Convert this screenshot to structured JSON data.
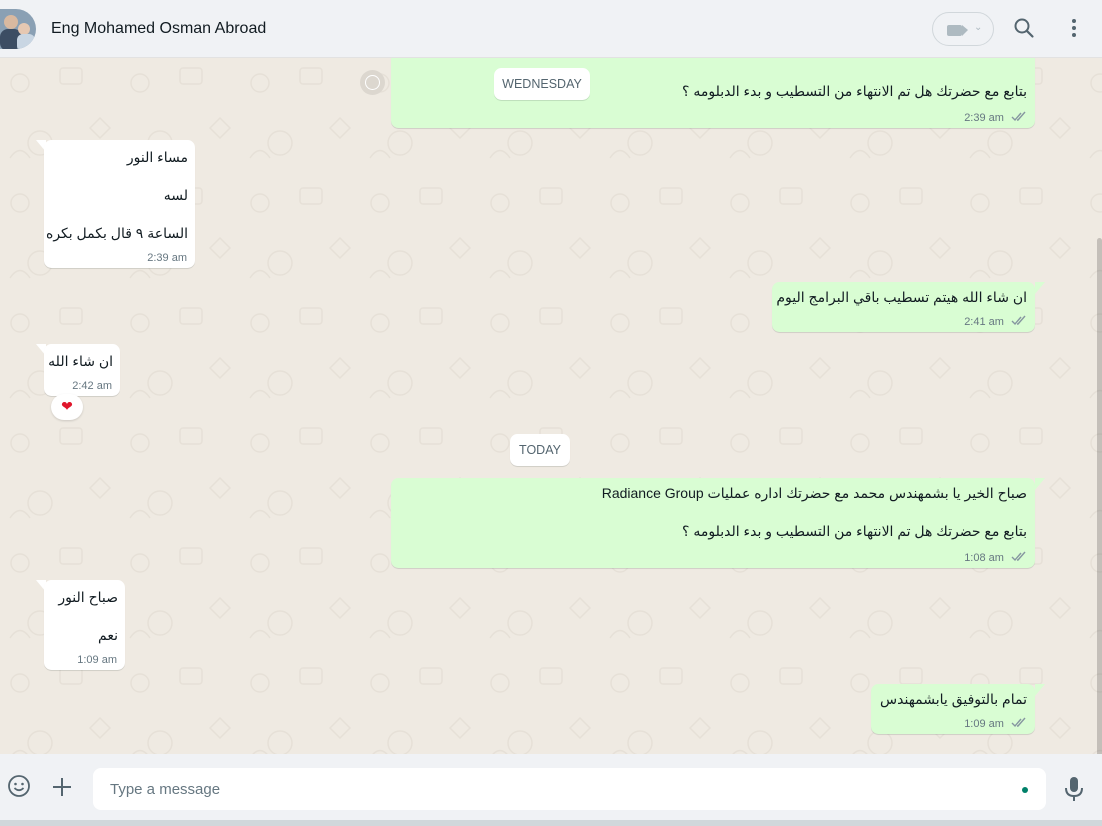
{
  "header": {
    "contact_name": "Eng Mohamed Osman Abroad",
    "icons": {
      "video": "video-call-icon",
      "search": "search-icon",
      "menu": "menu-icon"
    }
  },
  "chips": {
    "wednesday": "WEDNESDAY",
    "today": "TODAY"
  },
  "messages": [
    {
      "direction": "out",
      "lines": [
        "بتابع مع حضرتك هل تم الانتهاء من التسطيب و بدء الدبلومه ؟"
      ],
      "time": "2:39 am",
      "status": "read"
    },
    {
      "direction": "in",
      "lines": [
        "مساء النور",
        "لسه",
        "الساعة ٩ قال بكمل بكره"
      ],
      "time": "2:39 am"
    },
    {
      "direction": "out",
      "lines": [
        "ان شاء الله هيتم تسطيب باقي البرامج اليوم"
      ],
      "time": "2:41 am",
      "status": "read"
    },
    {
      "direction": "in",
      "lines": [
        "ان شاء الله"
      ],
      "time": "2:42 am",
      "reaction": "❤"
    },
    {
      "direction": "out",
      "lines": [
        "صباح الخير يا بشمهندس محمد مع حضرتك اداره عمليات Radiance Group",
        "بتابع مع حضرتك هل تم الانتهاء من التسطيب و بدء الدبلومه ؟"
      ],
      "time": "1:08 am",
      "status": "read"
    },
    {
      "direction": "in",
      "lines": [
        "صباح النور",
        "نعم"
      ],
      "time": "1:09 am"
    },
    {
      "direction": "out",
      "lines": [
        "تمام بالتوفيق يابشمهندس"
      ],
      "time": "1:09 am",
      "status": "read"
    }
  ],
  "footer": {
    "placeholder": "Type a message",
    "icons": {
      "emoji": "emoji-icon",
      "attach": "plus-icon",
      "mic": "microphone-icon"
    }
  },
  "colors": {
    "chat_background": "#efeae2",
    "outgoing_bubble": "#d9fdd3",
    "incoming_bubble": "#ffffff",
    "read_ticks": "#8696a0"
  }
}
